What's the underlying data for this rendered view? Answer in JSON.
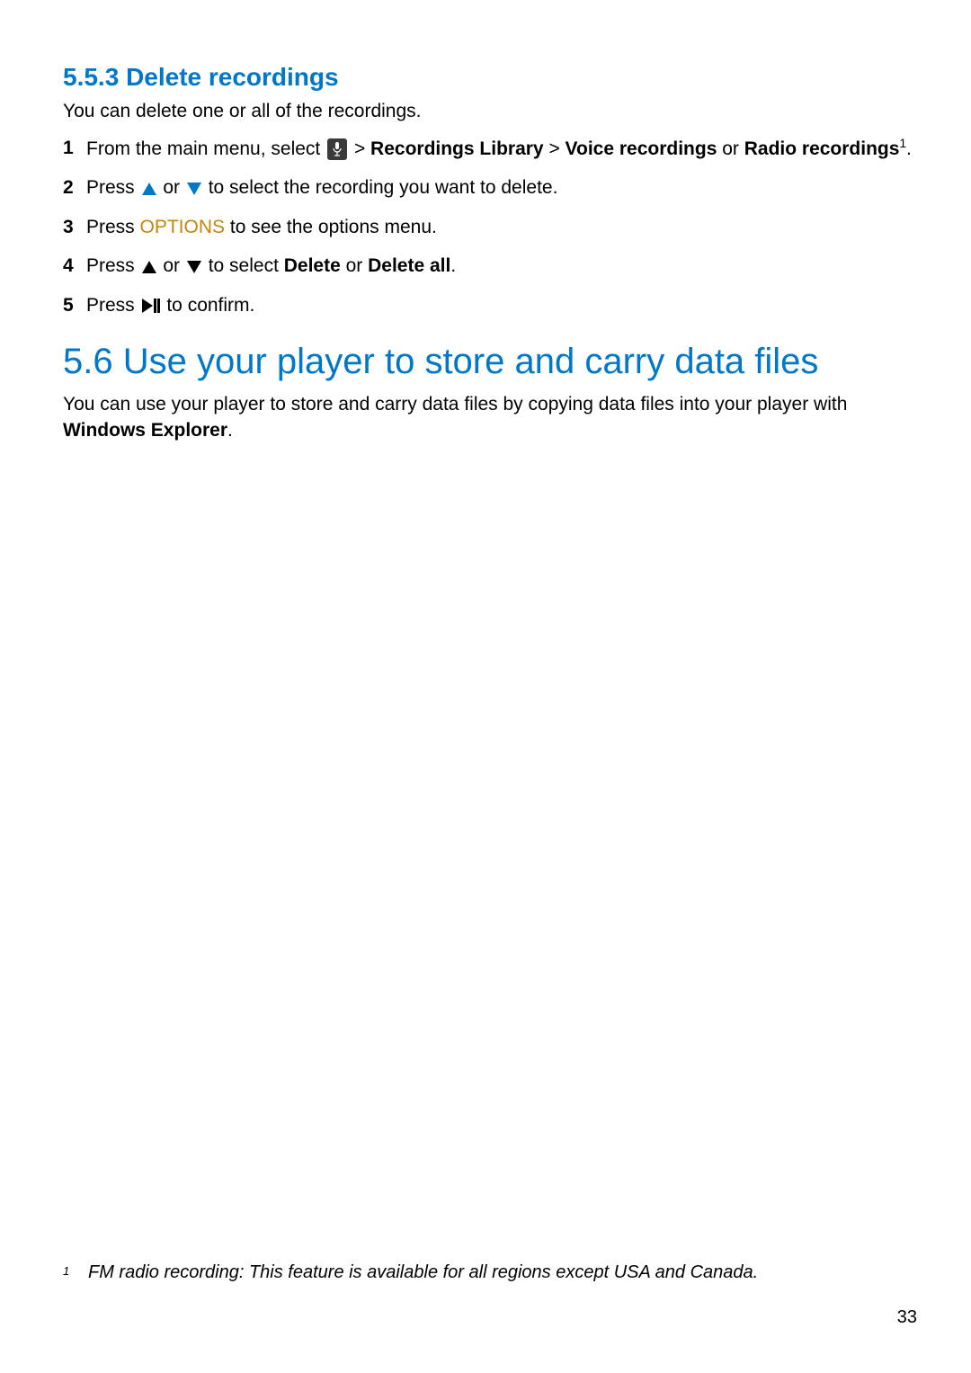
{
  "section_553": {
    "number": "5.5.3",
    "title": "Delete recordings",
    "intro": "You can delete one or all of the recordings.",
    "steps": {
      "s1_num": "1",
      "s1_a": "From the main menu, select ",
      "s1_b": " > ",
      "s1_c": "Recordings Library",
      "s1_d": " > ",
      "s1_e": "Voice recordings",
      "s1_f": " or ",
      "s1_g": "Radio recordings",
      "s1_sup": "1",
      "s1_end": ".",
      "s2_num": "2",
      "s2_a": "Press ",
      "s2_b": " or ",
      "s2_c": " to select the recording you want to delete.",
      "s3_num": "3",
      "s3_a": "Press ",
      "s3_options": "OPTIONS",
      "s3_b": " to see the options menu.",
      "s4_num": "4",
      "s4_a": "Press ",
      "s4_b": " or ",
      "s4_c": " to select ",
      "s4_delete": "Delete",
      "s4_d": " or ",
      "s4_deleteall": "Delete all",
      "s4_e": ".",
      "s5_num": "5",
      "s5_a": "Press ",
      "s5_b": " to confirm."
    }
  },
  "section_56": {
    "number": "5.6",
    "title": "Use your player to store and carry data files",
    "body_a": "You can use your player to store and carry data files by copying data files into your player with ",
    "body_b": "Windows Explorer",
    "body_c": "."
  },
  "footnote": {
    "num": "1",
    "text": "FM radio recording: This feature is available for all regions except USA and Canada."
  },
  "page_number": "33"
}
